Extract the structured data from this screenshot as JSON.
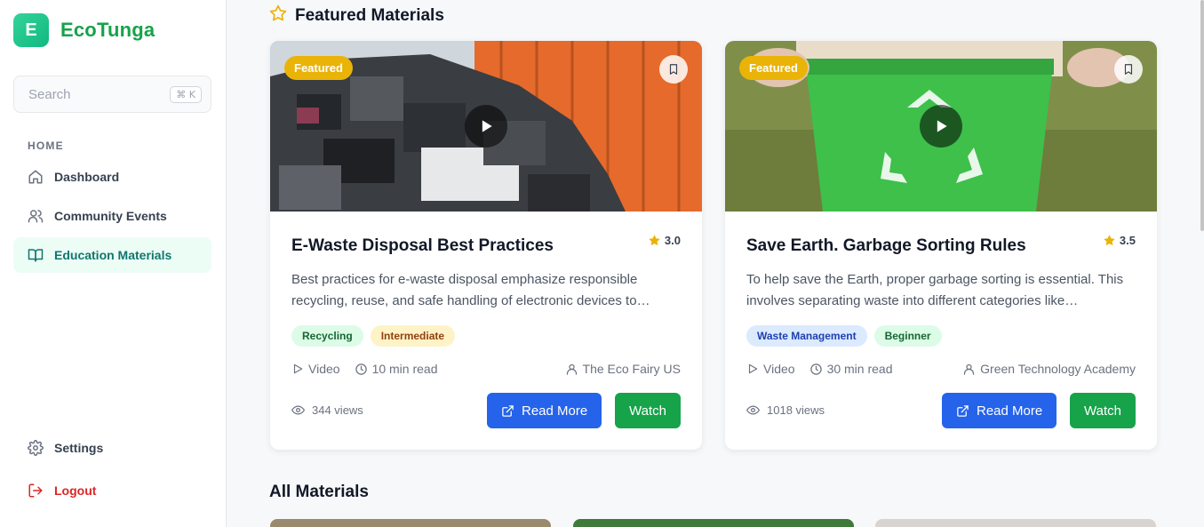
{
  "app": {
    "logo_letter": "E",
    "name": "EcoTunga"
  },
  "search": {
    "placeholder": "Search",
    "shortcut": "⌘ K"
  },
  "sidebar": {
    "section_label": "HOME",
    "items": [
      {
        "label": "Dashboard",
        "icon": "home-icon"
      },
      {
        "label": "Community Events",
        "icon": "users-icon"
      },
      {
        "label": "Education Materials",
        "icon": "book-open-icon",
        "active": true
      }
    ],
    "settings_label": "Settings",
    "logout_label": "Logout"
  },
  "featured": {
    "title": "Featured Materials",
    "cards": [
      {
        "badge": "Featured",
        "title": "E-Waste Disposal Best Practices",
        "rating": "3.0",
        "description": "Best practices for e-waste disposal emphasize responsible recycling, reuse, and safe handling of electronic devices to…",
        "tags": [
          "Recycling",
          "Intermediate"
        ],
        "type": "Video",
        "duration": "10 min read",
        "author": "The Eco Fairy US",
        "views": "344 views",
        "read_more": "Read More",
        "watch": "Watch"
      },
      {
        "badge": "Featured",
        "title": "Save Earth. Garbage Sorting Rules",
        "rating": "3.5",
        "description": "To help save the Earth, proper garbage sorting is essential. This involves separating waste into different categories like…",
        "tags": [
          "Waste Management",
          "Beginner"
        ],
        "type": "Video",
        "duration": "30 min read",
        "author": "Green Technology Academy",
        "views": "1018 views",
        "read_more": "Read More",
        "watch": "Watch"
      }
    ]
  },
  "all_materials": {
    "title": "All Materials"
  },
  "colors": {
    "brand": "#16a34a",
    "primary_button": "#2563eb",
    "watch_button": "#16a34a",
    "featured_badge": "#eab308",
    "active_nav_bg": "#ecfdf5"
  }
}
